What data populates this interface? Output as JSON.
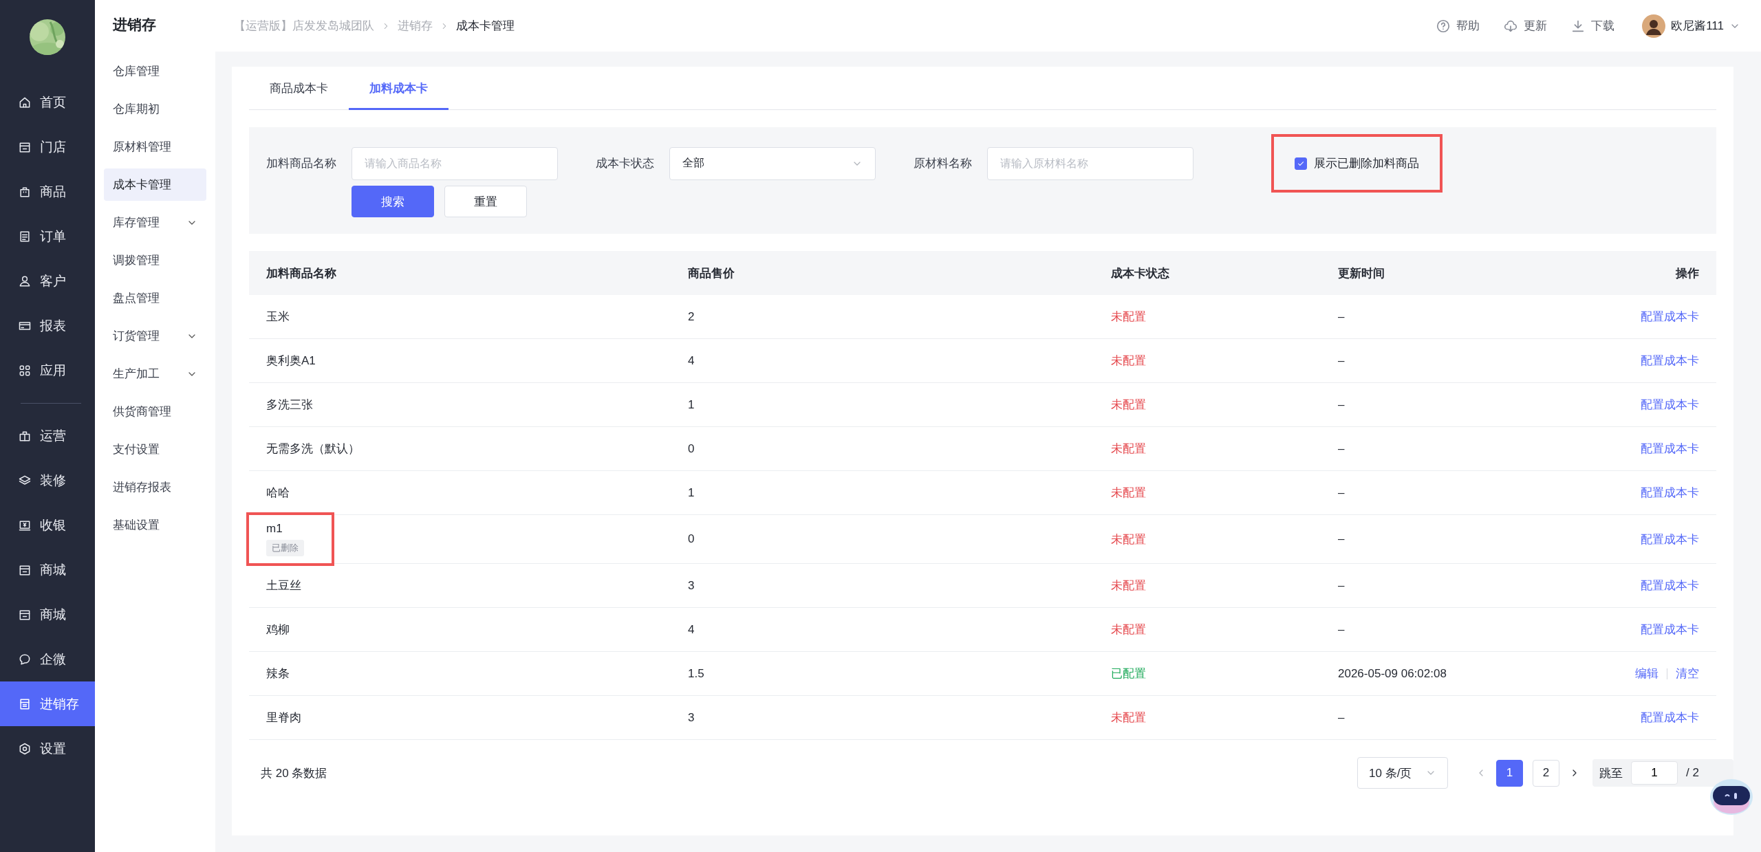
{
  "nav": {
    "items": [
      {
        "label": "首页",
        "selected": false
      },
      {
        "label": "门店",
        "selected": false
      },
      {
        "label": "商品",
        "selected": false
      },
      {
        "label": "订单",
        "selected": false
      },
      {
        "label": "客户",
        "selected": false
      },
      {
        "label": "报表",
        "selected": false
      },
      {
        "label": "应用",
        "selected": false
      },
      {
        "label": "运营",
        "divider_before": true,
        "selected": false
      },
      {
        "label": "装修",
        "selected": false
      },
      {
        "label": "收银",
        "selected": false
      },
      {
        "label": "商城",
        "selected": false
      },
      {
        "label": "商城",
        "selected": false
      },
      {
        "label": "企微",
        "selected": false
      },
      {
        "label": "进销存",
        "selected": true
      },
      {
        "label": "设置",
        "selected": false
      }
    ]
  },
  "submenu": {
    "title": "进销存",
    "items": [
      {
        "label": "仓库管理",
        "expandable": false,
        "selected": false
      },
      {
        "label": "仓库期初",
        "expandable": false,
        "selected": false
      },
      {
        "label": "原材料管理",
        "expandable": false,
        "selected": false
      },
      {
        "label": "成本卡管理",
        "expandable": false,
        "selected": true
      },
      {
        "label": "库存管理",
        "expandable": true,
        "selected": false
      },
      {
        "label": "调拨管理",
        "expandable": false,
        "selected": false
      },
      {
        "label": "盘点管理",
        "expandable": false,
        "selected": false
      },
      {
        "label": "订货管理",
        "expandable": true,
        "selected": false
      },
      {
        "label": "生产加工",
        "expandable": true,
        "selected": false
      },
      {
        "label": "供货商管理",
        "expandable": false,
        "selected": false
      },
      {
        "label": "支付设置",
        "expandable": false,
        "selected": false
      },
      {
        "label": "进销存报表",
        "expandable": false,
        "selected": false
      },
      {
        "label": "基础设置",
        "expandable": false,
        "selected": false
      }
    ]
  },
  "header": {
    "breadcrumbs": [
      "【运营版】店发发岛城团队",
      "进销存",
      "成本卡管理"
    ],
    "actions": [
      {
        "label": "帮助",
        "kind": "help"
      },
      {
        "label": "更新",
        "kind": "update"
      },
      {
        "label": "下载",
        "kind": "download"
      }
    ],
    "user": {
      "name": "欧尼酱111"
    }
  },
  "tabs": [
    {
      "label": "商品成本卡",
      "selected": false
    },
    {
      "label": "加料成本卡",
      "selected": true
    }
  ],
  "filters": [
    {
      "kind": "input",
      "label": "加料商品名称",
      "placeholder": "请输入商品名称"
    },
    {
      "kind": "select",
      "label": "成本卡状态",
      "value": "全部"
    },
    {
      "kind": "input",
      "label": "原材料名称",
      "placeholder": "请输入原材料名称"
    }
  ],
  "show_deleted": {
    "label": "展示已删除加料商品",
    "checked": true,
    "highlighted": true
  },
  "buttons": [
    {
      "label": "搜索",
      "kind": "primary"
    },
    {
      "label": "重置",
      "kind": "default"
    }
  ],
  "table": {
    "columns": [
      "加料商品名称",
      "商品售价",
      "成本卡状态",
      "更新时间",
      "操作"
    ],
    "rows": [
      {
        "name": "玉米",
        "price": "2",
        "status": "未配置",
        "configured": false,
        "updated": "–",
        "actions": [
          "配置成本卡"
        ]
      },
      {
        "name": "奥利奥A1",
        "price": "4",
        "status": "未配置",
        "configured": false,
        "updated": "–",
        "actions": [
          "配置成本卡"
        ]
      },
      {
        "name": "多洗三张",
        "price": "1",
        "status": "未配置",
        "configured": false,
        "updated": "–",
        "actions": [
          "配置成本卡"
        ]
      },
      {
        "name": "无需多洗（默认）",
        "price": "0",
        "status": "未配置",
        "configured": false,
        "updated": "–",
        "actions": [
          "配置成本卡"
        ]
      },
      {
        "name": "哈哈",
        "price": "1",
        "status": "未配置",
        "configured": false,
        "updated": "–",
        "actions": [
          "配置成本卡"
        ]
      },
      {
        "name": "m1",
        "tag": "已删除",
        "highlighted": true,
        "price": "0",
        "status": "未配置",
        "configured": false,
        "updated": "–",
        "actions": [
          "配置成本卡"
        ]
      },
      {
        "name": "土豆丝",
        "price": "3",
        "status": "未配置",
        "configured": false,
        "updated": "–",
        "actions": [
          "配置成本卡"
        ]
      },
      {
        "name": "鸡柳",
        "price": "4",
        "status": "未配置",
        "configured": false,
        "updated": "–",
        "actions": [
          "配置成本卡"
        ]
      },
      {
        "name": "辣条",
        "price": "1.5",
        "status": "已配置",
        "configured": true,
        "updated": "2026-05-09 06:02:08",
        "actions": [
          "编辑",
          "清空"
        ]
      },
      {
        "name": "里脊肉",
        "price": "3",
        "status": "未配置",
        "configured": false,
        "updated": "–",
        "actions": [
          "配置成本卡"
        ]
      }
    ]
  },
  "pagination": {
    "total": "共 20 条数据",
    "page_size": "10 条/页",
    "pages": [
      {
        "label": "1",
        "selected": true
      },
      {
        "label": "2",
        "selected": false
      }
    ],
    "jump_label": "跳至",
    "jump_value": "1",
    "page_count": "/ 2"
  }
}
